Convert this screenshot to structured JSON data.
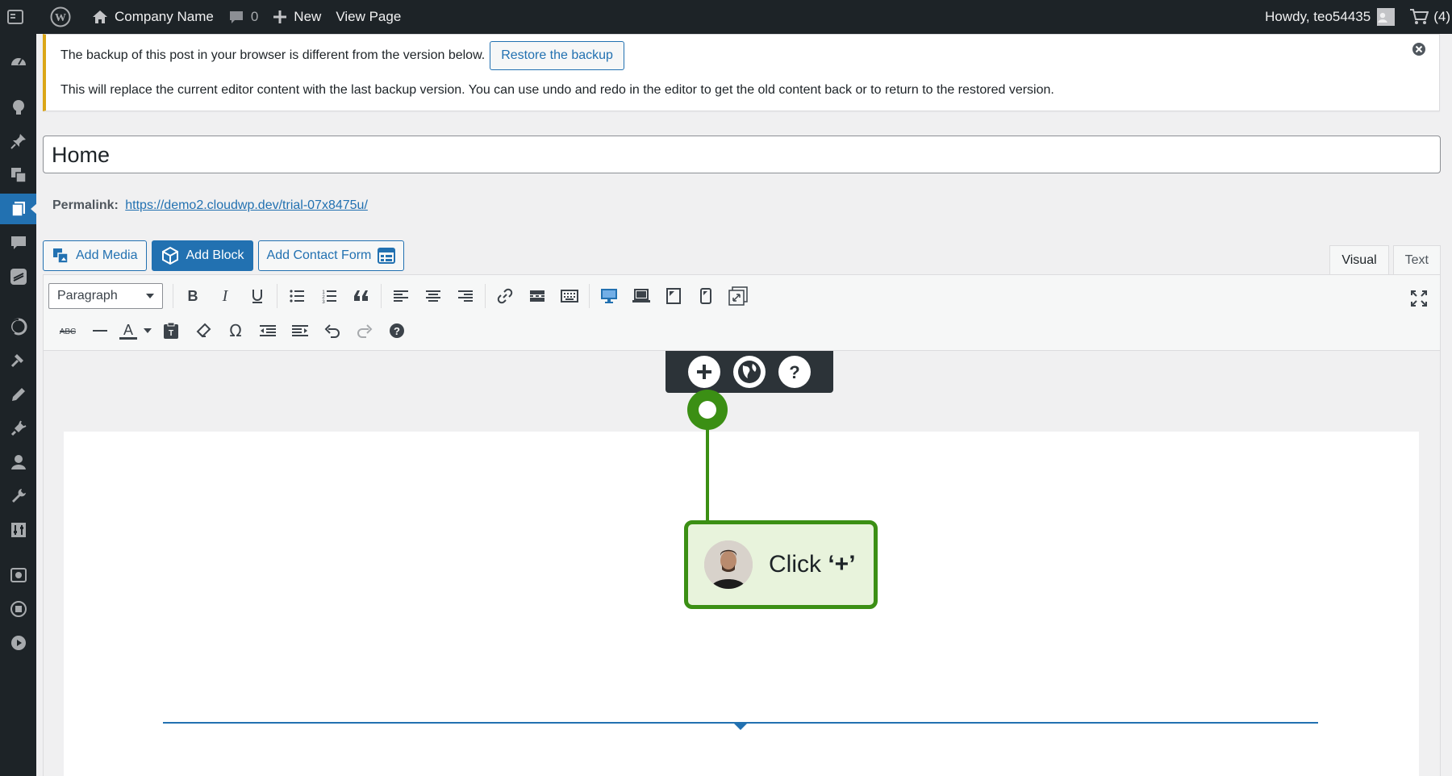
{
  "adminbar": {
    "site_name": "Company Name",
    "comments_count": "0",
    "new_label": "New",
    "view_page_label": "View Page",
    "howdy": "Howdy, teo54435",
    "cart_count": "(4)"
  },
  "notice": {
    "message": "The backup of this post in your browser is different from the version below.",
    "restore_label": "Restore the backup",
    "detail": "This will replace the current editor content with the last backup version. You can use undo and redo in the editor to get the old content back or to return to the restored version."
  },
  "title": {
    "value": "Home"
  },
  "permalink": {
    "label": "Permalink:",
    "url": "https://demo2.cloudwp.dev/trial-07x8475u/"
  },
  "media_buttons": {
    "add_media": "Add Media",
    "add_block": "Add Block",
    "add_contact_form": "Add Contact Form"
  },
  "editor_tabs": {
    "visual": "Visual",
    "text": "Text"
  },
  "toolbar": {
    "format_value": "Paragraph"
  },
  "guide": {
    "tip_prefix": "Click ",
    "tip_symbol": "‘+’"
  },
  "colors": {
    "accent": "#2271b1",
    "guide_green": "#3b8f14",
    "notice_warning": "#dba617",
    "adminbar_bg": "#1d2327"
  }
}
